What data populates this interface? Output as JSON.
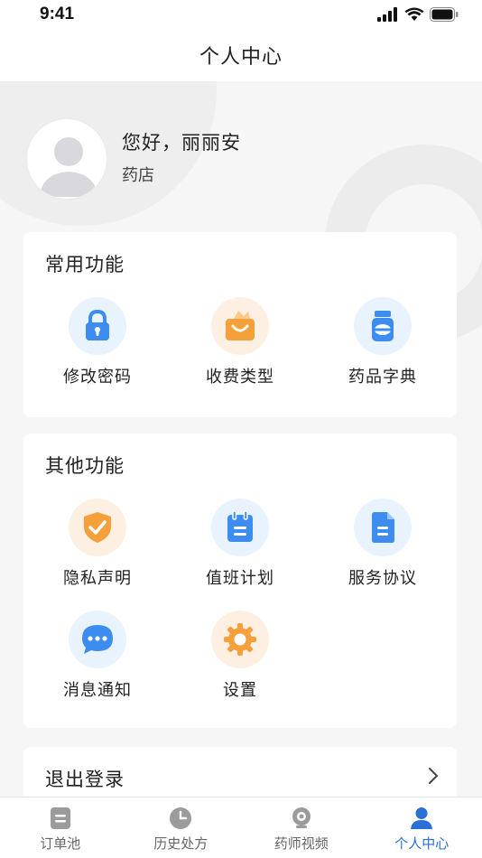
{
  "status_bar": {
    "time": "9:41"
  },
  "nav": {
    "title": "个人中心"
  },
  "profile": {
    "greeting": "您好，丽丽安",
    "role": "药店"
  },
  "common_functions": {
    "title": "常用功能",
    "items": [
      {
        "label": "修改密码",
        "icon": "lock-icon"
      },
      {
        "label": "收费类型",
        "icon": "shopping-bag-icon"
      },
      {
        "label": "药品字典",
        "icon": "medicine-bottle-icon"
      }
    ]
  },
  "other_functions": {
    "title": "其他功能",
    "items": [
      {
        "label": "隐私声明",
        "icon": "shield-check-icon"
      },
      {
        "label": "值班计划",
        "icon": "calendar-icon"
      },
      {
        "label": "服务协议",
        "icon": "document-icon"
      },
      {
        "label": "消息通知",
        "icon": "chat-bubble-icon"
      },
      {
        "label": "设置",
        "icon": "gear-icon"
      }
    ]
  },
  "logout": {
    "label": "退出登录"
  },
  "tab_bar": {
    "items": [
      {
        "label": "订单池",
        "icon": "order-icon",
        "active": false
      },
      {
        "label": "历史处方",
        "icon": "clock-icon",
        "active": false
      },
      {
        "label": "药师视频",
        "icon": "camera-icon",
        "active": false
      },
      {
        "label": "个人中心",
        "icon": "person-icon",
        "active": true
      }
    ]
  },
  "colors": {
    "accent_blue": "#2a6fd6",
    "icon_blue": "#3d8cf0",
    "icon_orange": "#f5a03a"
  }
}
